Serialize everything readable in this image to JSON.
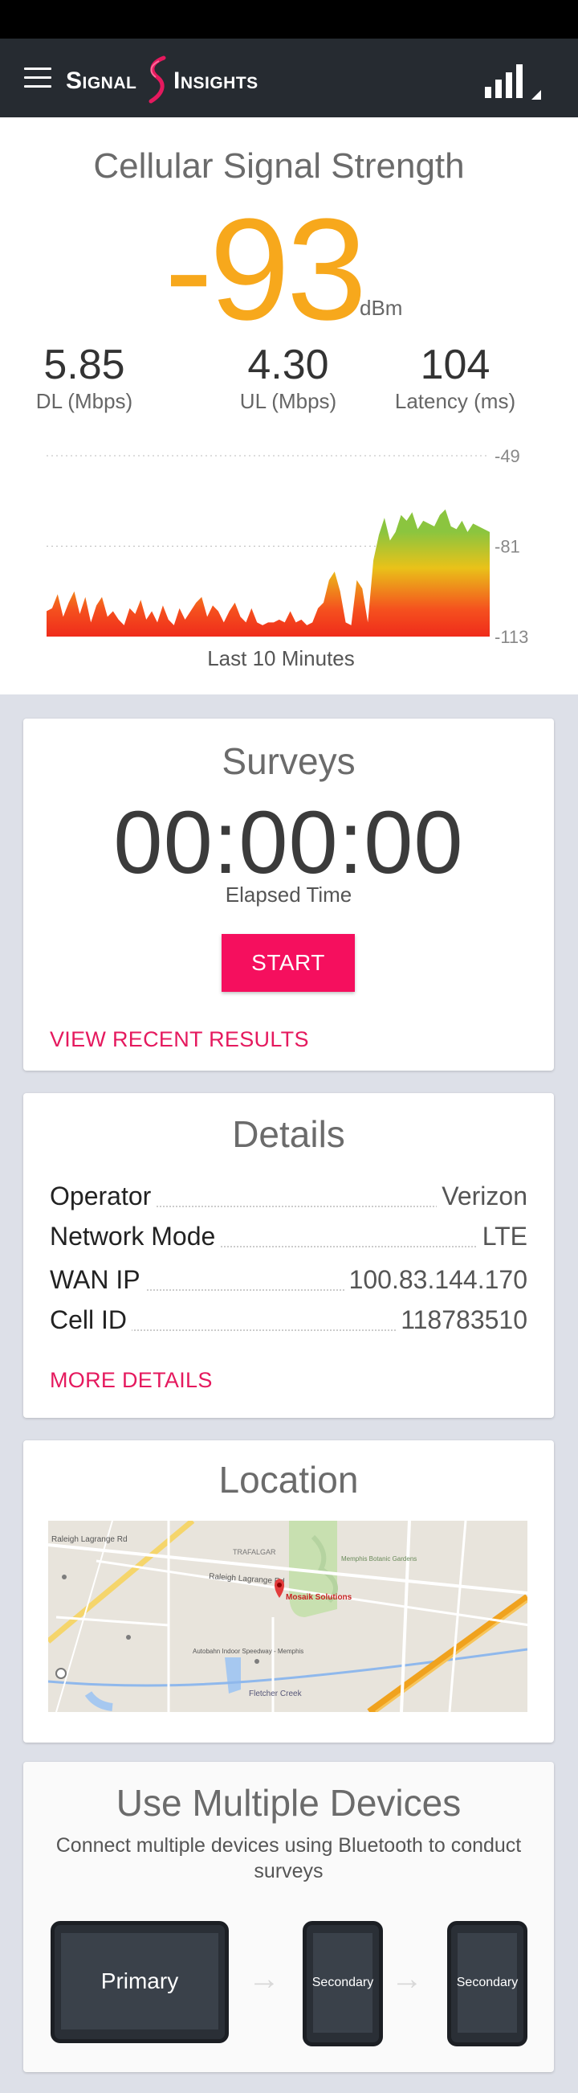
{
  "app": {
    "brand_left": "Signal",
    "brand_right": "Insights",
    "menu_icon": "hamburger-menu-icon",
    "signal_icon": "cell-signal-icon"
  },
  "hero": {
    "title": "Cellular Signal Strength",
    "signal_value": "-93",
    "signal_unit": "dBm",
    "metrics": [
      {
        "value": "5.85",
        "label": "DL (Mbps)"
      },
      {
        "value": "4.30",
        "label": "UL (Mbps)"
      },
      {
        "value": "104",
        "label": "Latency (ms)"
      }
    ],
    "caption": "Last 10 Minutes"
  },
  "chart_data": {
    "type": "area",
    "title": "",
    "xlabel": "Last 10 Minutes",
    "ylabel": "",
    "y_ticks": [
      "-49",
      "-81",
      "-113"
    ],
    "ylim": [
      -113,
      -49
    ],
    "grid": true,
    "values": [
      -104,
      -103,
      -98,
      -106,
      -101,
      -97,
      -105,
      -99,
      -108,
      -102,
      -99,
      -106,
      -104,
      -107,
      -109,
      -103,
      -105,
      -100,
      -107,
      -104,
      -108,
      -102,
      -107,
      -109,
      -103,
      -107,
      -104,
      -101,
      -99,
      -106,
      -102,
      -104,
      -108,
      -104,
      -101,
      -106,
      -108,
      -103,
      -108,
      -109,
      -108,
      -108,
      -107,
      -108,
      -104,
      -108,
      -107,
      -109,
      -108,
      -103,
      -101,
      -93,
      -90,
      -97,
      -108,
      -109,
      -93,
      -96,
      -108,
      -86,
      -77,
      -71,
      -79,
      -76,
      -70,
      -72,
      -69,
      -75,
      -72,
      -73,
      -74,
      -70,
      -68,
      -74,
      -75,
      -72,
      -76,
      -73,
      -74,
      -75,
      -76
    ],
    "colors": {
      "high": "#8bc53f",
      "mid": "#e9c219",
      "low": "#f5511e",
      "base": "#ef2b1b"
    }
  },
  "surveys": {
    "title": "Surveys",
    "elapsed": "00:00:00",
    "elapsed_label": "Elapsed Time",
    "start_label": "START",
    "link_label": "VIEW RECENT RESULTS"
  },
  "details": {
    "title": "Details",
    "rows": [
      {
        "key": "Operator",
        "value": "Verizon"
      },
      {
        "key": "Network Mode",
        "value": "LTE"
      },
      {
        "key": "WAN IP",
        "value": "100.83.144.170"
      },
      {
        "key": "Cell ID",
        "value": "118783510"
      }
    ],
    "link_label": "MORE DETAILS"
  },
  "location": {
    "title": "Location",
    "map_labels": {
      "road1": "Raleigh Lagrange Rd",
      "road2": "Raleigh Lagrange Rd",
      "poi_name": "Mosaik Solutions",
      "gardens": "Memphis Botanic Gardens",
      "area": "TRAFALGAR",
      "creek": "Fletcher Creek",
      "speedway": "Autobahn Indoor Speedway - Memphis"
    }
  },
  "devices": {
    "title": "Use Multiple Devices",
    "subtitle": "Connect multiple devices using Bluetooth to conduct surveys",
    "primary_label": "Primary",
    "secondary_label_1": "Secondary",
    "secondary_label_2": "Secondary"
  }
}
